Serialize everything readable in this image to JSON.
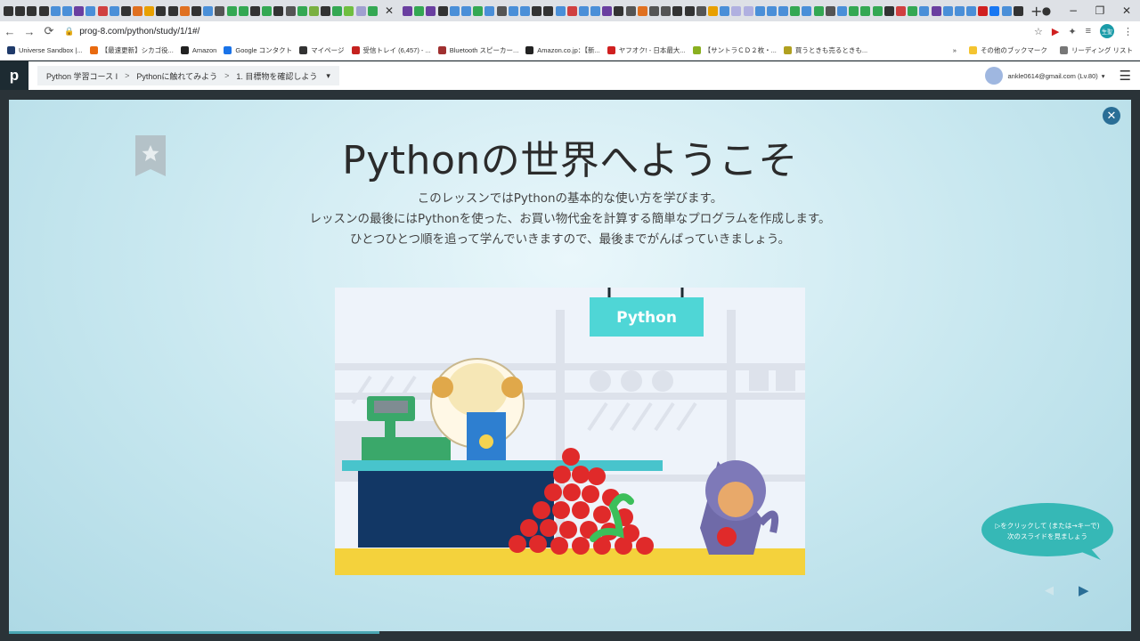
{
  "tab_favicon_colors": [
    "#333",
    "#333",
    "#333",
    "#333",
    "#4a8fd8",
    "#4a8fd8",
    "#6a3fa0",
    "#4a8fd8",
    "#d04040",
    "#4a8fd8",
    "#333",
    "#e07020",
    "#e8a000",
    "#333",
    "#333",
    "#e07020",
    "#333",
    "#4a8fd8",
    "#555",
    "#34a853",
    "#34a853",
    "#333",
    "#34a853",
    "#333",
    "#555",
    "#34a853",
    "#7ab040",
    "#333",
    "#34a853",
    "#6fbf40",
    "#a0a0d0",
    "#34a853"
  ],
  "tab_favicon_colors_after": [
    "#6a3fa0",
    "#34a853",
    "#6a3fa0",
    "#333",
    "#4a8fd8",
    "#4a8fd8",
    "#34a853",
    "#4a8fd8",
    "#555",
    "#4a8fd8",
    "#4a8fd8",
    "#333",
    "#333",
    "#4a8fd8",
    "#d04040",
    "#4a8fd8",
    "#4a8fd8",
    "#6a3fa0",
    "#333",
    "#555",
    "#e07020",
    "#555",
    "#555",
    "#333",
    "#333",
    "#555",
    "#e8a000",
    "#4a8fd8",
    "#b0b0e0",
    "#b0b0e0",
    "#4a8fd8",
    "#4a8fd8",
    "#4a8fd8",
    "#34a853",
    "#4a8fd8",
    "#34a853",
    "#555",
    "#4a8fd8",
    "#34a853",
    "#34a853",
    "#34a853",
    "#333",
    "#d04040",
    "#34a853",
    "#4a8fd8",
    "#6a3fa0",
    "#4a8fd8",
    "#4a8fd8",
    "#4a8fd8",
    "#d02020",
    "#1877f2",
    "#4a8fd8",
    "#333"
  ],
  "browser": {
    "url": "prog-8.com/python/study/1/1#/",
    "new_tab": "+",
    "tab_close": "✕",
    "back": "←",
    "forward": "→",
    "reload": "⟳",
    "profile_label": "生聖",
    "window_min": "−",
    "window_max": "❐",
    "window_close": "✕"
  },
  "bookmarks": [
    {
      "label": "Universe Sandbox |...",
      "color": "#1f3a6a"
    },
    {
      "label": "【最速更新】シカゴ役...",
      "color": "#e86a10"
    },
    {
      "label": "Amazon",
      "color": "#222"
    },
    {
      "label": "Google コンタクト",
      "color": "#1a73e8"
    },
    {
      "label": "マイページ",
      "color": "#333"
    },
    {
      "label": "受信トレイ (6,457) - ...",
      "color": "#c5221f"
    },
    {
      "label": "Bluetooth スピーカー...",
      "color": "#a03030"
    },
    {
      "label": "Amazon.co.jp：【新...",
      "color": "#222"
    },
    {
      "label": "ヤフオク! - 日本最大...",
      "color": "#d02020"
    },
    {
      "label": "【サントラＣＤ２枚・...",
      "color": "#8ab020"
    },
    {
      "label": "買うときも売るときも...",
      "color": "#b0a020"
    }
  ],
  "bookmarks_right": {
    "more": "»",
    "other": "その他のブックマーク",
    "reading_list": "リーディング リスト"
  },
  "app": {
    "logo_text": "p",
    "breadcrumb": [
      "Python 学習コース I",
      "Pythonに触れてみよう",
      "1. 目標物を確認しよう"
    ],
    "crumb_sep": ">",
    "dropdown": "▾",
    "user_email": "ankle0614@gmail.com (Lv.80)",
    "menu": "☰"
  },
  "slide": {
    "title": "Pythonの世界へようこそ",
    "desc_lines": [
      "このレッスンではPythonの基本的な使い方を学びます。",
      "レッスンの最後にはPythonを使った、お買い物代金を計算する簡単なプログラムを作成します。",
      "ひとつひとつ順を追って学んでいきますので、最後までがんばっていきましょう。"
    ],
    "sign_text": "Python",
    "bubble_lines": [
      "▷をクリックして (または→キーで)",
      "次のスライドを見ましょう"
    ],
    "close": "✕",
    "prev": "◀",
    "next": "▶",
    "progress_fraction": 0.33
  }
}
